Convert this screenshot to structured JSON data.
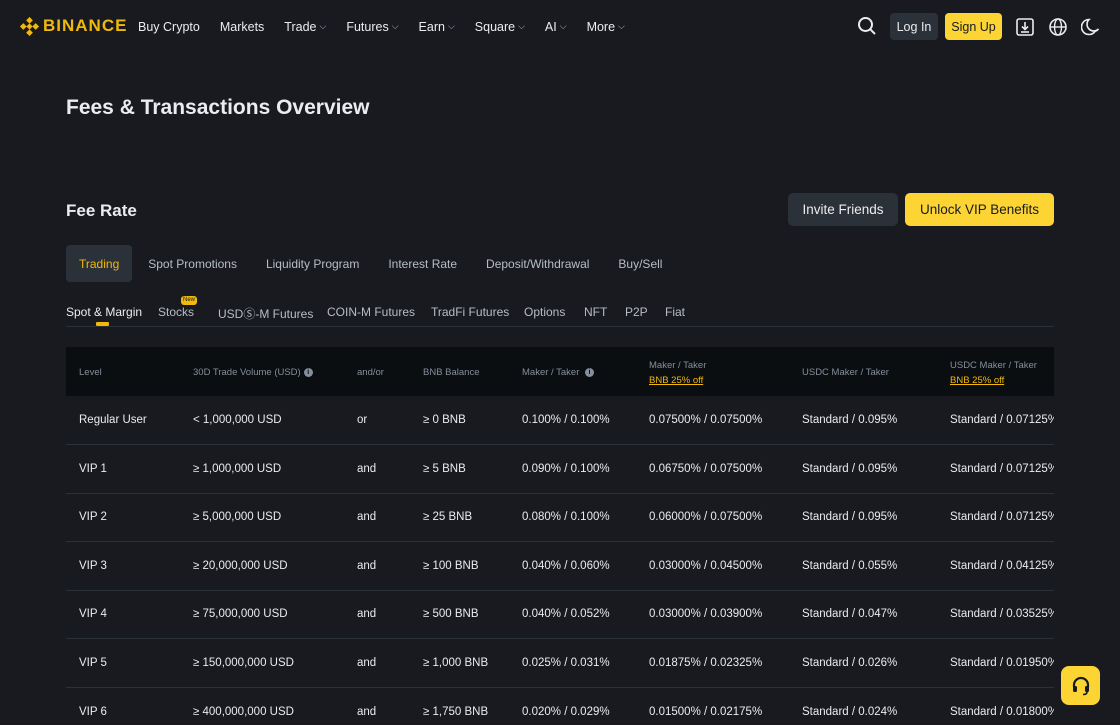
{
  "brand": {
    "name": "BINANCE",
    "color": "#f0b90b"
  },
  "nav": [
    {
      "label": "Buy Crypto",
      "dropdown": false
    },
    {
      "label": "Markets",
      "dropdown": false
    },
    {
      "label": "Trade",
      "dropdown": true
    },
    {
      "label": "Futures",
      "dropdown": true
    },
    {
      "label": "Earn",
      "dropdown": true
    },
    {
      "label": "Square",
      "dropdown": true
    },
    {
      "label": "AI",
      "dropdown": true
    },
    {
      "label": "More",
      "dropdown": true
    }
  ],
  "header": {
    "login": "Log In",
    "signup": "Sign Up",
    "icons": [
      "search-icon",
      "download-icon",
      "globe-icon",
      "moon-icon"
    ]
  },
  "page_title": "Fees & Transactions Overview",
  "fee_section": {
    "title": "Fee Rate",
    "invite_button": "Invite Friends",
    "vip_button": "Unlock VIP Benefits"
  },
  "tabs": [
    "Trading",
    "Spot Promotions",
    "Liquidity Program",
    "Interest Rate",
    "Deposit/Withdrawal",
    "Buy/Sell"
  ],
  "active_tab": "Trading",
  "subtabs": [
    "Spot & Margin",
    "Stocks",
    "USDⓈ-M Futures",
    "COIN-M Futures",
    "TradFi Futures",
    "Options",
    "NFT",
    "P2P",
    "Fiat"
  ],
  "active_subtab": "Spot & Margin",
  "new_badge": "New",
  "table": {
    "headers": {
      "level": "Level",
      "volume": "30D Trade Volume (USD)",
      "andor": "and/or",
      "bnb_balance": "BNB Balance",
      "maker_taker": "Maker / Taker",
      "maker_taker_bnb": "Maker / Taker",
      "maker_taker_bnb_sub": "BNB 25% off",
      "usdc_maker_taker": "USDC Maker / Taker",
      "usdc_maker_taker_bnb": "USDC Maker / Taker",
      "usdc_maker_taker_bnb_sub": "BNB 25% off"
    },
    "rows": [
      {
        "level": "Regular User",
        "volume": "< 1,000,000 USD",
        "andor": "or",
        "bnb": "≥ 0 BNB",
        "mt": "0.100% / 0.100%",
        "mt_bnb": "0.07500% / 0.07500%",
        "usdc": "Standard / 0.095%",
        "usdc_bnb": "Standard / 0.07125%"
      },
      {
        "level": "VIP 1",
        "volume": "≥ 1,000,000 USD",
        "andor": "and",
        "bnb": "≥ 5 BNB",
        "mt": "0.090% / 0.100%",
        "mt_bnb": "0.06750% / 0.07500%",
        "usdc": "Standard / 0.095%",
        "usdc_bnb": "Standard / 0.07125%"
      },
      {
        "level": "VIP 2",
        "volume": "≥ 5,000,000 USD",
        "andor": "and",
        "bnb": "≥ 25 BNB",
        "mt": "0.080% / 0.100%",
        "mt_bnb": "0.06000% / 0.07500%",
        "usdc": "Standard / 0.095%",
        "usdc_bnb": "Standard / 0.07125%"
      },
      {
        "level": "VIP 3",
        "volume": "≥ 20,000,000 USD",
        "andor": "and",
        "bnb": "≥ 100 BNB",
        "mt": "0.040% / 0.060%",
        "mt_bnb": "0.03000% / 0.04500%",
        "usdc": "Standard / 0.055%",
        "usdc_bnb": "Standard / 0.04125%"
      },
      {
        "level": "VIP 4",
        "volume": "≥ 75,000,000 USD",
        "andor": "and",
        "bnb": "≥ 500 BNB",
        "mt": "0.040% / 0.052%",
        "mt_bnb": "0.03000% / 0.03900%",
        "usdc": "Standard / 0.047%",
        "usdc_bnb": "Standard / 0.03525%"
      },
      {
        "level": "VIP 5",
        "volume": "≥ 150,000,000 USD",
        "andor": "and",
        "bnb": "≥ 1,000 BNB",
        "mt": "0.025% / 0.031%",
        "mt_bnb": "0.01875% / 0.02325%",
        "usdc": "Standard / 0.026%",
        "usdc_bnb": "Standard / 0.01950%"
      },
      {
        "level": "VIP 6",
        "volume": "≥ 400,000,000 USD",
        "andor": "and",
        "bnb": "≥ 1,750 BNB",
        "mt": "0.020% / 0.029%",
        "mt_bnb": "0.01500% / 0.02175%",
        "usdc": "Standard / 0.024%",
        "usdc_bnb": "Standard / 0.01800%"
      }
    ]
  },
  "colors": {
    "background": "#181a20",
    "accent": "#fcd535",
    "text": "#eaecef",
    "muted": "#848e9c"
  }
}
